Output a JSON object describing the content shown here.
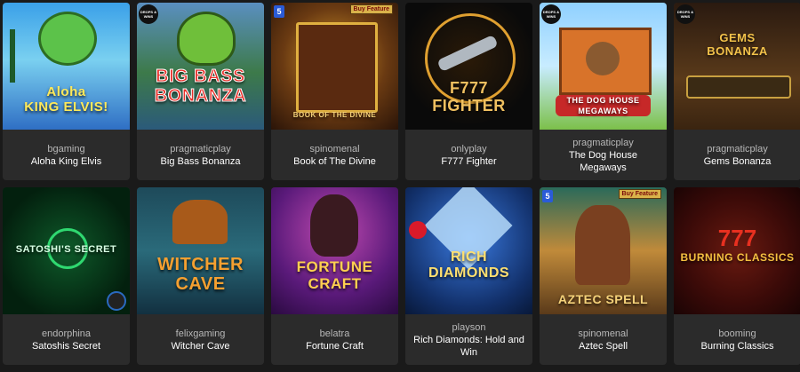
{
  "games": [
    {
      "provider": "bgaming",
      "name": "Aloha King Elvis",
      "art": "Aloha\nKING ELVIS!",
      "badge": "",
      "buy_feature": ""
    },
    {
      "provider": "pragmaticplay",
      "name": "Big Bass Bonanza",
      "art": "BIG BASS\nBONANZA",
      "badge": "DROPS & WINS",
      "buy_feature": ""
    },
    {
      "provider": "spinomenal",
      "name": "Book of The Divine",
      "art": "BOOK OF THE DIVINE",
      "badge": "5",
      "buy_feature": "Buy Feature"
    },
    {
      "provider": "onlyplay",
      "name": "F777 Fighter",
      "art": "F777\nFIGHTER",
      "badge": "",
      "buy_feature": ""
    },
    {
      "provider": "pragmaticplay",
      "name": "The Dog House Megaways",
      "art": "THE DOG HOUSE\nMEGAWAYS",
      "badge": "DROPS & WINS",
      "buy_feature": ""
    },
    {
      "provider": "pragmaticplay",
      "name": "Gems Bonanza",
      "art": "GEMS\nBONANZA",
      "badge": "DROPS & WINS",
      "buy_feature": ""
    },
    {
      "provider": "endorphina",
      "name": "Satoshis Secret",
      "art": "SATOSHI'S SECRET",
      "badge": "",
      "buy_feature": ""
    },
    {
      "provider": "felixgaming",
      "name": "Witcher Cave",
      "art": "WITCHER\nCAVE",
      "badge": "",
      "buy_feature": ""
    },
    {
      "provider": "belatra",
      "name": "Fortune Craft",
      "art": "FORTUNE\nCRAFT",
      "badge": "",
      "buy_feature": ""
    },
    {
      "provider": "playson",
      "name": "Rich Diamonds: Hold and Win",
      "art": "RICH\nDIAMONDS",
      "badge": "",
      "buy_feature": ""
    },
    {
      "provider": "spinomenal",
      "name": "Aztec Spell",
      "art": "AZTEC SPELL",
      "badge": "5",
      "buy_feature": "Buy Feature"
    },
    {
      "provider": "booming",
      "name": "Burning Classics",
      "art": "BURNING CLASSICS",
      "badge": "",
      "buy_feature": ""
    }
  ]
}
